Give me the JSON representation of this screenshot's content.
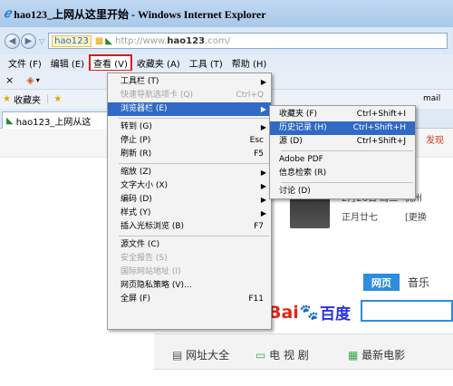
{
  "window": {
    "title": "hao123_上网从这里开始 - Windows Internet Explorer"
  },
  "address": {
    "site_badge": "hao123",
    "url_prefix": "http://www.",
    "url_host": "hao123",
    "url_suffix": ".com/"
  },
  "menubar": {
    "items": [
      "文件 (F)",
      "编辑 (E)",
      "查看 (V)",
      "收藏夹 (A)",
      "工具 (T)",
      "帮助 (H)"
    ]
  },
  "commandbar": {
    "close": "×"
  },
  "favbar": {
    "favorites": "收藏夹",
    "strip_text": "mail"
  },
  "tab": {
    "label": "hao123_上网从这"
  },
  "page": {
    "hint": "发现",
    "date": "2月26日 周三",
    "city": "杭州",
    "lunar": "正月廿七",
    "lunar_extra": "[更换",
    "search_tabs": [
      "网页",
      "音乐"
    ],
    "logo_text": [
      "Bai",
      "百度"
    ],
    "nav_items": [
      "网址大全",
      "电 视 剧",
      "最新电影"
    ]
  },
  "view_menu": [
    {
      "label": "工具栏 (T)",
      "submenu": true
    },
    {
      "label": "快速导航选项卡 (Q)",
      "shortcut": "Ctrl+Q",
      "disabled": true
    },
    {
      "label": "浏览器栏 (E)",
      "submenu": true,
      "highlighted": true
    },
    {
      "sep": true
    },
    {
      "label": "转到 (G)",
      "submenu": true
    },
    {
      "label": "停止 (P)",
      "shortcut": "Esc"
    },
    {
      "label": "刷新 (R)",
      "shortcut": "F5"
    },
    {
      "sep": true
    },
    {
      "label": "缩放 (Z)",
      "submenu": true
    },
    {
      "label": "文字大小 (X)",
      "submenu": true
    },
    {
      "label": "编码 (D)",
      "submenu": true
    },
    {
      "label": "样式 (Y)",
      "submenu": true
    },
    {
      "label": "插入光标浏览 (B)",
      "shortcut": "F7"
    },
    {
      "sep": true
    },
    {
      "label": "源文件 (C)"
    },
    {
      "label": "安全报告 (S)",
      "disabled": true
    },
    {
      "label": "国际网站地址 (I)",
      "disabled": true
    },
    {
      "label": "网页隐私策略 (V)..."
    },
    {
      "label": "全屏 (F)",
      "shortcut": "F11"
    }
  ],
  "explorer_bar_menu": [
    {
      "label": "收藏夹 (F)",
      "shortcut": "Ctrl+Shift+I"
    },
    {
      "label": "历史记录 (H)",
      "shortcut": "Ctrl+Shift+H",
      "highlighted": true
    },
    {
      "label": "源 (D)",
      "shortcut": "Ctrl+Shift+J"
    },
    {
      "sep": true
    },
    {
      "label": "Adobe PDF"
    },
    {
      "label": "信息检索 (R)"
    },
    {
      "sep": true
    },
    {
      "label": "讨论 (D)"
    }
  ]
}
